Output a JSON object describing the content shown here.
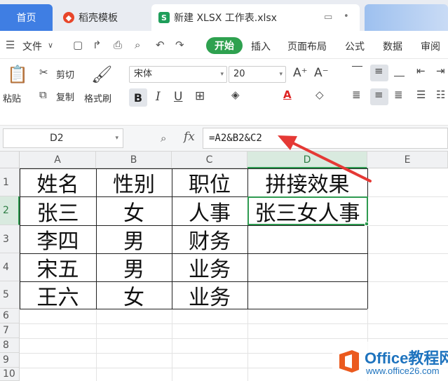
{
  "tabs": {
    "home": "首页",
    "template": "稻壳模板",
    "file": "新建 XLSX 工作表.xlsx"
  },
  "menu": {
    "file": "文件",
    "items": [
      "开始",
      "插入",
      "页面布局",
      "公式",
      "数据",
      "审阅"
    ]
  },
  "ribbon": {
    "paste": "粘贴",
    "cut": "剪切",
    "copy": "复制",
    "format_painter": "格式刷",
    "font_name": "宋体",
    "font_size": "20"
  },
  "formula_bar": {
    "name_box": "D2",
    "fx": "fx",
    "formula": "=A2&B2&C2"
  },
  "sheet": {
    "columns": [
      "A",
      "B",
      "C",
      "D",
      "E"
    ],
    "rows": [
      "1",
      "2",
      "3",
      "4",
      "5",
      "6",
      "7",
      "8",
      "9",
      "10"
    ],
    "selected_cell": "D2",
    "cells": [
      [
        "姓名",
        "性别",
        "职位",
        "拼接效果"
      ],
      [
        "张三",
        "女",
        "人事",
        "张三女人事"
      ],
      [
        "李四",
        "男",
        "财务",
        ""
      ],
      [
        "宋五",
        "男",
        "业务",
        ""
      ],
      [
        "王六",
        "女",
        "业务",
        ""
      ]
    ]
  },
  "watermark": {
    "title": "Office教程网",
    "url": "www.office26.com"
  },
  "colors": {
    "accent_green": "#2e9a50",
    "home_tab_blue": "#3f7ee3",
    "annotation_red": "#e53935"
  }
}
